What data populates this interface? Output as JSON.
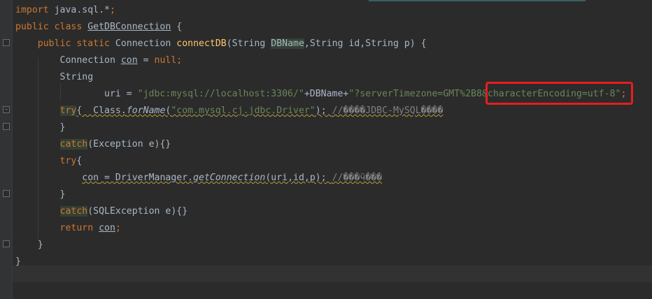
{
  "editor": {
    "lines": [
      [
        {
          "t": "import ",
          "c": "kw"
        },
        {
          "t": "java.sql.*",
          "c": ""
        },
        {
          "t": ";",
          "c": "kw"
        }
      ],
      [
        {
          "t": "public ",
          "c": "kw"
        },
        {
          "t": "class ",
          "c": "kw"
        },
        {
          "t": "GetDBConnection",
          "c": "ul"
        },
        {
          "t": " {",
          "c": ""
        }
      ],
      [
        {
          "t": "    "
        },
        {
          "t": "public ",
          "c": "kw"
        },
        {
          "t": "static ",
          "c": "kw"
        },
        {
          "t": "Connection ",
          "c": ""
        },
        {
          "t": "connectDB",
          "c": "fn"
        },
        {
          "t": "(String ",
          "c": ""
        },
        {
          "t": "DBName",
          "c": "hl"
        },
        {
          "t": ",String id,String p) {",
          "c": ""
        }
      ],
      [
        {
          "t": "        Connection ",
          "c": ""
        },
        {
          "t": "con",
          "c": "ul"
        },
        {
          "t": " = ",
          "c": ""
        },
        {
          "t": "null",
          "c": "kw"
        },
        {
          "t": ";",
          "c": "kw"
        }
      ],
      [
        {
          "t": "        String",
          "c": ""
        }
      ],
      [
        {
          "t": "                uri = ",
          "c": ""
        },
        {
          "t": "\"jdbc:mysql://localhost:3306/\"",
          "c": "str"
        },
        {
          "t": "+DBName+",
          "c": ""
        },
        {
          "t": "\"?serverTimezone=GMT%2B8&characterEncoding=utf-8\"",
          "c": "str"
        },
        {
          "t": ";",
          "c": "kw"
        }
      ],
      [
        {
          "t": "        "
        },
        {
          "t": "try",
          "c": "kw hl"
        },
        {
          "t": "{  Class.",
          "c": "warn"
        },
        {
          "t": "forName",
          "c": "warn ital"
        },
        {
          "t": "(",
          "c": "warn"
        },
        {
          "t": "\"com.mysql.cj.jdbc.Driver\"",
          "c": "str warn"
        },
        {
          "t": "); ",
          "c": "warn"
        },
        {
          "t": "//����JDBC-MySQL����",
          "c": "cmt warn"
        }
      ],
      [
        {
          "t": "        }",
          "c": ""
        }
      ],
      [
        {
          "t": "        "
        },
        {
          "t": "catch",
          "c": "kw hl"
        },
        {
          "t": "(Exception e){}",
          "c": ""
        }
      ],
      [
        {
          "t": "        "
        },
        {
          "t": "try",
          "c": "kw"
        },
        {
          "t": "{",
          "c": ""
        }
      ],
      [
        {
          "t": "            "
        },
        {
          "t": "con",
          "c": "warn"
        },
        {
          "t": " = DriverManager.",
          "c": "warn"
        },
        {
          "t": "getConnection",
          "c": "warn ital"
        },
        {
          "t": "(uri,id,p); ",
          "c": "warn"
        },
        {
          "t": "//���ӵ���",
          "c": "cmt warn"
        }
      ],
      [
        {
          "t": "        }",
          "c": ""
        }
      ],
      [
        {
          "t": "        "
        },
        {
          "t": "catch",
          "c": "kw hl"
        },
        {
          "t": "(SQLException e){}",
          "c": ""
        }
      ],
      [
        {
          "t": "        "
        },
        {
          "t": "return ",
          "c": "kw"
        },
        {
          "t": "con",
          "c": "ul"
        },
        {
          "t": ";",
          "c": "kw"
        }
      ],
      [
        {
          "t": "    }",
          "c": ""
        }
      ],
      [
        {
          "t": "}",
          "c": ""
        }
      ]
    ]
  },
  "annotation": {
    "color": "#e61e1e"
  }
}
